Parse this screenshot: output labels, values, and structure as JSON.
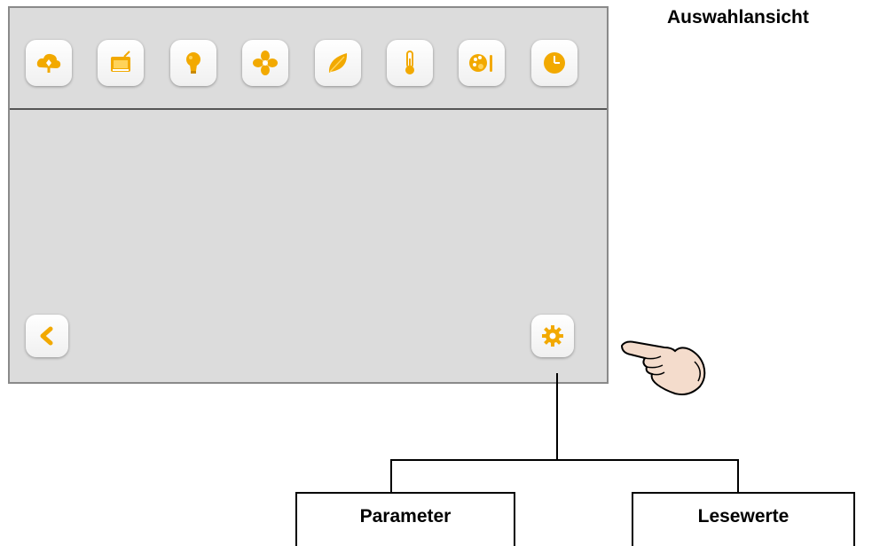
{
  "title": "Auswahlansicht",
  "toolbar": {
    "icons": [
      "cloud-icon",
      "display-icon",
      "lightbulb-icon",
      "fan-icon",
      "leaf-icon",
      "thermometer-icon",
      "palette-icon",
      "clock-icon"
    ]
  },
  "nav": {
    "back_icon": "chevron-left-icon",
    "settings_icon": "gear-icon"
  },
  "tree": {
    "left_label": "Parameter",
    "right_label": "Lesewerte"
  },
  "colors": {
    "accent": "#f2a900",
    "accent_light": "#ffd35a",
    "panel_bg": "#dcdcdc",
    "panel_border": "#8a8a8a"
  }
}
